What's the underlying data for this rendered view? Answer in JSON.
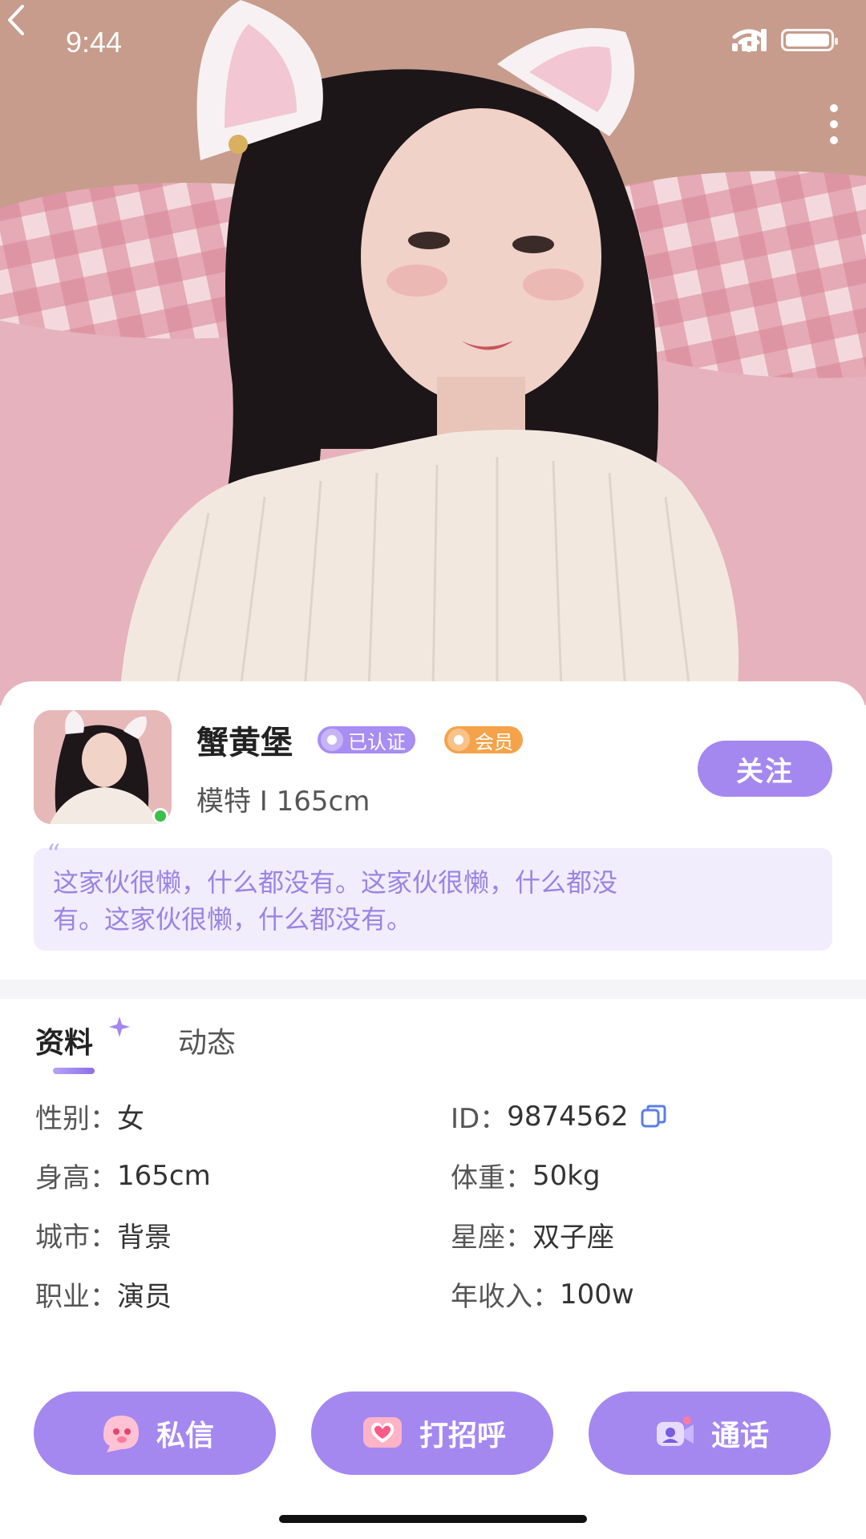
{
  "status_bar": {
    "time": "9:44"
  },
  "profile": {
    "nickname": "蟹黄堡",
    "verified_badge": "已认证",
    "vip_badge": "会员",
    "subtitle": "模特 I 165cm",
    "follow_label": "关注",
    "bio_line1": "这家伙很懒，什么都没有。这家伙很懒，什么都没",
    "bio_line2": "有。这家伙很懒，什么都没有。",
    "online": true
  },
  "tabs": [
    {
      "label": "资料",
      "active": true
    },
    {
      "label": "动态",
      "active": false
    }
  ],
  "info": {
    "gender": {
      "label": "性别：",
      "value": "女"
    },
    "id": {
      "label": "ID：",
      "value": "9874562"
    },
    "height": {
      "label": "身高：",
      "value": "165cm"
    },
    "weight": {
      "label": "体重：",
      "value": "50kg"
    },
    "city": {
      "label": "城市：",
      "value": "背景"
    },
    "zodiac": {
      "label": "星座：",
      "value": "双子座"
    },
    "job": {
      "label": "职业：",
      "value": "演员"
    },
    "income": {
      "label": "年收入：",
      "value": "100w"
    }
  },
  "actions": {
    "dm_label": "私信",
    "greet_label": "打招呼",
    "call_label": "通话"
  },
  "colors": {
    "accent": "#a488f0",
    "bio_bg": "#f1edfc",
    "bio_text": "#9a84e4",
    "vip": "#f5a34a",
    "online": "#3cc04a"
  }
}
